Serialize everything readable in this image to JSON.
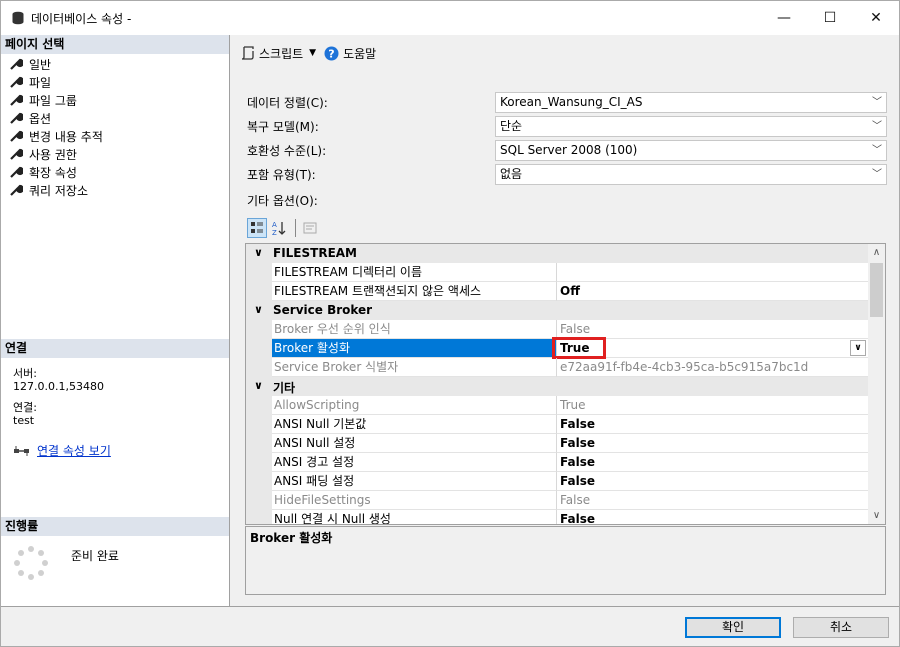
{
  "window": {
    "title": "데이터베이스 속성 -",
    "minimize": "—",
    "maximize": "☐",
    "close": "✕"
  },
  "left": {
    "header": "페이지 선택",
    "pages": [
      "일반",
      "파일",
      "파일 그룹",
      "옵션",
      "변경 내용 추적",
      "사용 권한",
      "확장 속성",
      "쿼리 저장소"
    ],
    "connection": {
      "header": "연결",
      "server_label": "서버:",
      "server_value": "127.0.0.1,53480",
      "conn_label": "연결:",
      "conn_value": "test",
      "link": "연결 속성 보기"
    },
    "progress": {
      "header": "진행률",
      "status": "준비 완료"
    }
  },
  "toolbar": {
    "script": "스크립트",
    "help": "도움말"
  },
  "form": {
    "collation_label": "데이터 정렬(C):",
    "collation_value": "Korean_Wansung_CI_AS",
    "recovery_label": "복구 모델(M):",
    "recovery_value": "단순",
    "compat_label": "호환성 수준(L):",
    "compat_value": "SQL Server 2008 (100)",
    "containment_label": "포함 유형(T):",
    "containment_value": "없음",
    "other_label": "기타 옵션(O):"
  },
  "grid": {
    "rows": [
      {
        "type": "cat",
        "name": "FILESTREAM"
      },
      {
        "type": "prop",
        "name": "FILESTREAM 디렉터리 이름",
        "value": "",
        "bold": false,
        "gray": false
      },
      {
        "type": "prop",
        "name": "FILESTREAM 트랜잭션되지 않은 액세스",
        "value": "Off",
        "bold": true,
        "gray": false
      },
      {
        "type": "cat",
        "name": "Service Broker"
      },
      {
        "type": "prop",
        "name": "Broker 우선 순위 인식",
        "value": "False",
        "bold": false,
        "gray": true
      },
      {
        "type": "prop",
        "name": "Broker 활성화",
        "value": "True",
        "bold": true,
        "gray": false,
        "selected": true
      },
      {
        "type": "prop",
        "name": "Service Broker 식별자",
        "value": "e72aa91f-fb4e-4cb3-95ca-b5c915a7bc1d",
        "bold": false,
        "gray": true
      },
      {
        "type": "cat",
        "name": "기타"
      },
      {
        "type": "prop",
        "name": "AllowScripting",
        "value": "True",
        "bold": false,
        "gray": true
      },
      {
        "type": "prop",
        "name": "ANSI Null 기본값",
        "value": "False",
        "bold": true,
        "gray": false
      },
      {
        "type": "prop",
        "name": "ANSI Null 설정",
        "value": "False",
        "bold": true,
        "gray": false
      },
      {
        "type": "prop",
        "name": "ANSI 경고 설정",
        "value": "False",
        "bold": true,
        "gray": false
      },
      {
        "type": "prop",
        "name": "ANSI 패딩 설정",
        "value": "False",
        "bold": true,
        "gray": false
      },
      {
        "type": "prop",
        "name": "HideFileSettings",
        "value": "False",
        "bold": false,
        "gray": true
      },
      {
        "type": "prop",
        "name": "Null 연결 시 Null 생성",
        "value": "False",
        "bold": true,
        "gray": false
      }
    ],
    "description_title": "Broker 활성화"
  },
  "buttons": {
    "ok": "확인",
    "cancel": "취소"
  },
  "colors": {
    "selection": "#0078d7",
    "highlight_box": "#e02020",
    "section_header": "#dde3ec"
  }
}
